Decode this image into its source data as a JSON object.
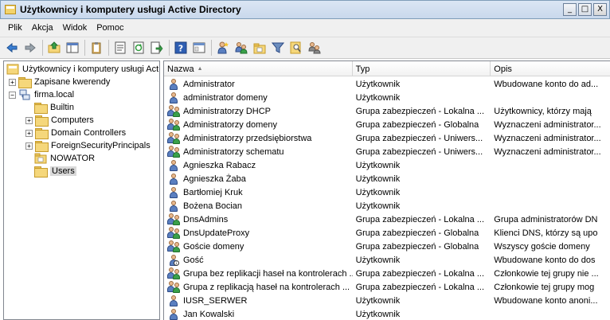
{
  "window": {
    "title": "Użytkownicy i komputery usługi Active Directory",
    "min_label": "_",
    "max_label": "□",
    "close_label": "X"
  },
  "menu": [
    "Plik",
    "Akcja",
    "Widok",
    "Pomoc"
  ],
  "toolbar": {
    "buttons": [
      "back-icon",
      "forward-icon",
      "up-folder-icon",
      "show-tree-icon",
      "clipboard-icon",
      "properties-icon",
      "refresh-icon",
      "export-icon",
      "help-icon",
      "console-icon",
      "new-user-icon",
      "new-group-icon",
      "new-ou-icon",
      "filter-icon",
      "find-icon",
      "add-to-group-icon"
    ]
  },
  "tree": {
    "root": "Użytkownicy i komputery usługi Act",
    "items": [
      {
        "label": "Zapisane kwerendy",
        "expander": "+",
        "level": 1
      },
      {
        "label": "firma.local",
        "expander": "−",
        "level": 1
      },
      {
        "label": "Builtin",
        "expander": "",
        "level": 2
      },
      {
        "label": "Computers",
        "expander": "+",
        "level": 2
      },
      {
        "label": "Domain Controllers",
        "expander": "+",
        "level": 2
      },
      {
        "label": "ForeignSecurityPrincipals",
        "expander": "+",
        "level": 2
      },
      {
        "label": "NOWATOR",
        "expander": "",
        "level": 2
      },
      {
        "label": "Users",
        "expander": "",
        "level": 2,
        "selected": true
      }
    ]
  },
  "list": {
    "columns": [
      "Nazwa",
      "Typ",
      "Opis"
    ],
    "sort_indicator": "▲",
    "rows": [
      {
        "name": "Administrator",
        "type": "Użytkownik",
        "desc": "Wbudowane konto do ad...",
        "icon": "user"
      },
      {
        "name": "administrator domeny",
        "type": "Użytkownik",
        "desc": "",
        "icon": "user"
      },
      {
        "name": "Administratorzy DHCP",
        "type": "Grupa zabezpieczeń - Lokalna ...",
        "desc": "Użytkownicy, którzy mają",
        "icon": "group"
      },
      {
        "name": "Administratorzy domeny",
        "type": "Grupa zabezpieczeń - Globalna",
        "desc": "Wyznaczeni administrator...",
        "icon": "group"
      },
      {
        "name": "Administratorzy przedsiębiorstwa",
        "type": "Grupa zabezpieczeń - Uniwers...",
        "desc": "Wyznaczeni administrator...",
        "icon": "group"
      },
      {
        "name": "Administratorzy schematu",
        "type": "Grupa zabezpieczeń - Uniwers...",
        "desc": "Wyznaczeni administrator...",
        "icon": "group"
      },
      {
        "name": "Agnieszka Rabacz",
        "type": "Użytkownik",
        "desc": "",
        "icon": "user"
      },
      {
        "name": "Agnieszka Żaba",
        "type": "Użytkownik",
        "desc": "",
        "icon": "user"
      },
      {
        "name": "Bartłomiej Kruk",
        "type": "Użytkownik",
        "desc": "",
        "icon": "user"
      },
      {
        "name": "Bożena Bocian",
        "type": "Użytkownik",
        "desc": "",
        "icon": "user"
      },
      {
        "name": "DnsAdmins",
        "type": "Grupa zabezpieczeń - Lokalna ...",
        "desc": "Grupa administratorów DN",
        "icon": "group"
      },
      {
        "name": "DnsUpdateProxy",
        "type": "Grupa zabezpieczeń - Globalna",
        "desc": "Klienci DNS, którzy są upo",
        "icon": "group"
      },
      {
        "name": "Goście domeny",
        "type": "Grupa zabezpieczeń - Globalna",
        "desc": "Wszyscy goście domeny",
        "icon": "group"
      },
      {
        "name": "Gość",
        "type": "Użytkownik",
        "desc": "Wbudowane konto do dos",
        "icon": "user-disabled"
      },
      {
        "name": "Grupa bez replikacji haseł na kontrolerach ...",
        "type": "Grupa zabezpieczeń - Lokalna ...",
        "desc": "Członkowie tej grupy nie ...",
        "icon": "group"
      },
      {
        "name": "Grupa z replikacją haseł na kontrolerach ...",
        "type": "Grupa zabezpieczeń - Lokalna ...",
        "desc": "Członkowie tej grupy mog",
        "icon": "group"
      },
      {
        "name": "IUSR_SERWER",
        "type": "Użytkownik",
        "desc": "Wbudowane konto anoni...",
        "icon": "user"
      },
      {
        "name": "Jan Kowalski",
        "type": "Użytkownik",
        "desc": "",
        "icon": "user"
      }
    ]
  }
}
